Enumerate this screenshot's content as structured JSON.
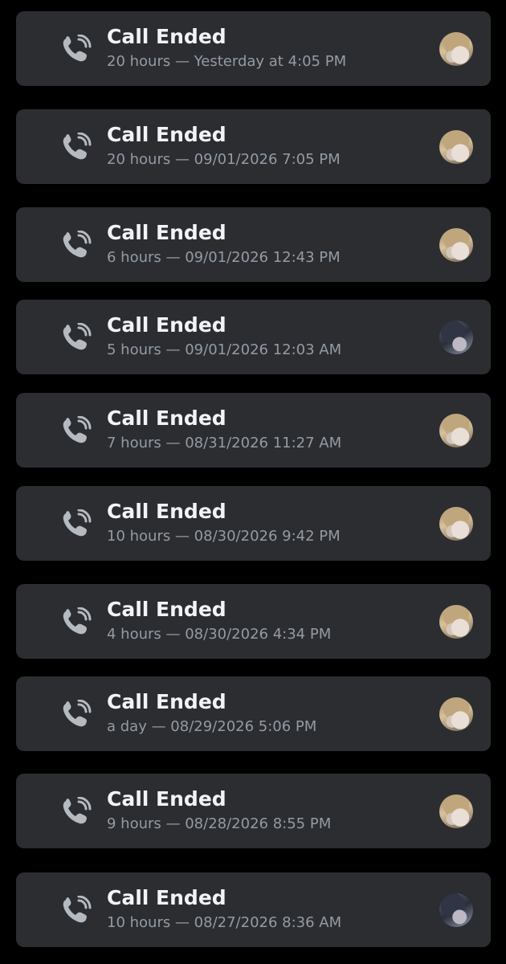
{
  "calls": [
    {
      "title": "Call Ended",
      "meta": "20 hours — Yesterday at 4:05 PM",
      "avatar": "blonde"
    },
    {
      "title": "Call Ended",
      "meta": "20 hours — 09/01/2026 7:05 PM",
      "avatar": "blonde"
    },
    {
      "title": "Call Ended",
      "meta": "6 hours — 09/01/2026 12:43 PM",
      "avatar": "blonde"
    },
    {
      "title": "Call Ended",
      "meta": "5 hours — 09/01/2026 12:03 AM",
      "avatar": "dark"
    },
    {
      "title": "Call Ended",
      "meta": "7 hours — 08/31/2026 11:27 AM",
      "avatar": "blonde"
    },
    {
      "title": "Call Ended",
      "meta": "10 hours — 08/30/2026 9:42 PM",
      "avatar": "blonde"
    },
    {
      "title": "Call Ended",
      "meta": "4 hours — 08/30/2026 4:34 PM",
      "avatar": "blonde"
    },
    {
      "title": "Call Ended",
      "meta": "a day — 08/29/2026 5:06 PM",
      "avatar": "blonde"
    },
    {
      "title": "Call Ended",
      "meta": "9 hours — 08/28/2026 8:55 PM",
      "avatar": "blonde"
    },
    {
      "title": "Call Ended",
      "meta": "10 hours — 08/27/2026 8:36 AM",
      "avatar": "dark"
    }
  ],
  "icons": {
    "call": "phone-call-icon"
  },
  "colors": {
    "background": "#000000",
    "card": "#2b2d31",
    "title": "#f2f3f5",
    "meta": "#949ba4",
    "icon": "#b5bac1"
  }
}
